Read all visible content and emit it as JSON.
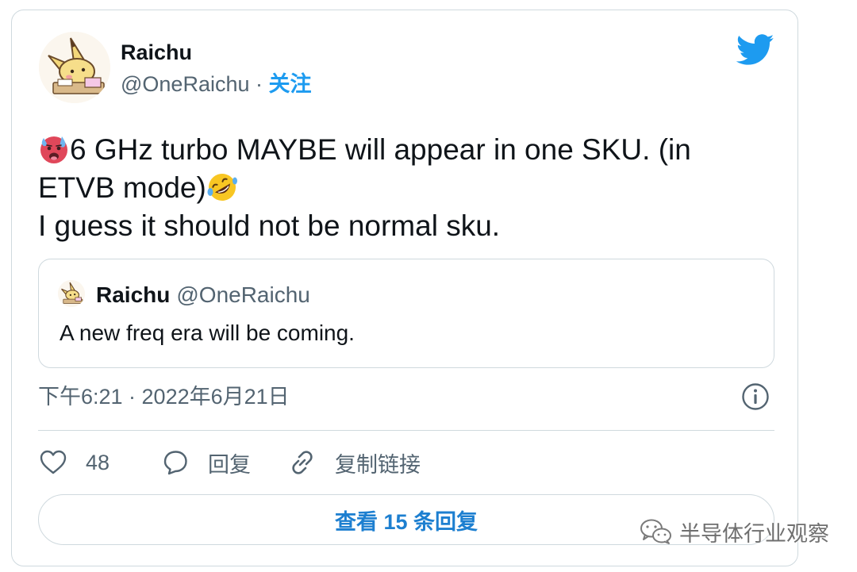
{
  "tweet": {
    "author_name": "Raichu",
    "author_handle": "@OneRaichu",
    "separator": "·",
    "follow_label": "关注",
    "text_line1": "6 GHz turbo MAYBE will appear in one SKU. (in",
    "text_line2": "ETVB mode)",
    "text_line3": "I guess it should not be normal sku.",
    "emoji_start": "hot-face-emoji",
    "emoji_end": "rolling-on-floor-laughing-emoji",
    "timestamp": "下午6:21 · 2022年6月21日"
  },
  "quoted_tweet": {
    "author_name": "Raichu",
    "author_handle": "@OneRaichu",
    "text": "A new freq era will be coming."
  },
  "actions": {
    "like_count": "48",
    "reply_label": "回复",
    "copy_link_label": "复制链接"
  },
  "replies_button_label": "查看 15 条回复",
  "watermark_text": "半导体行业观察",
  "icons": {
    "logo": "twitter-bird-icon",
    "info": "info-icon",
    "like": "heart-icon",
    "reply": "speech-bubble-icon",
    "link": "link-icon",
    "watermark": "wechat-icon"
  },
  "colors": {
    "accent": "#1d9bf0",
    "secondary_text": "#536471",
    "border": "#cfd9de",
    "text": "#0f1419"
  }
}
